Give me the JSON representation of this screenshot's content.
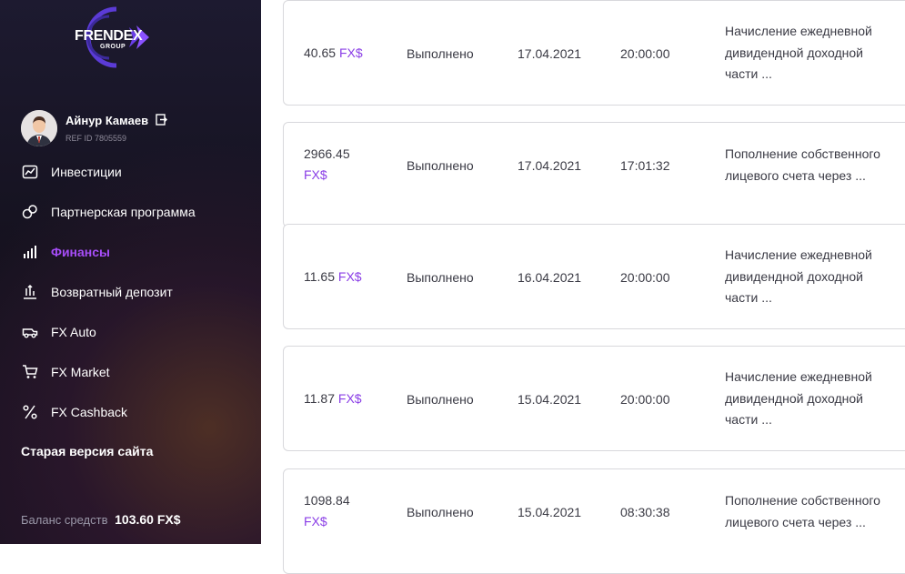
{
  "logo": {
    "main": "FRENDEX",
    "sub": "GROUP"
  },
  "user": {
    "name": "Айнур Камаев",
    "ref": "REF ID 7805559"
  },
  "menu": [
    {
      "label": "Инвестиции",
      "icon": "chart-icon",
      "active": false
    },
    {
      "label": "Партнерская программа",
      "icon": "partner-icon",
      "active": false
    },
    {
      "label": "Финансы",
      "icon": "finance-bars-icon",
      "active": true
    },
    {
      "label": "Возвратный депозит",
      "icon": "deposit-icon",
      "active": false
    },
    {
      "label": "FX Auto",
      "icon": "car-icon",
      "active": false
    },
    {
      "label": "FX Market",
      "icon": "cart-icon",
      "active": false
    },
    {
      "label": "FX Cashback",
      "icon": "percent-icon",
      "active": false
    }
  ],
  "old_site": "Старая версия сайта",
  "balance": {
    "label": "Баланс средств",
    "value": "103.60 FX$"
  },
  "colors": {
    "accent": "#a64df7",
    "sidebar_bg": "#1a1626"
  },
  "transactions": [
    {
      "amount": "40.65",
      "currency": "FX$",
      "status": "Выполнено",
      "date": "17.04.2021",
      "time": "20:00:00",
      "desc_lines": [
        "Начисление ежедневной",
        "дивидендной доходной",
        "части ..."
      ]
    },
    {
      "amount": "2966.45",
      "currency": "FX$",
      "status": "Выполнено",
      "date": "17.04.2021",
      "time": "17:01:32",
      "desc_lines": [
        "Пополнение собственного",
        "лицевого счета через ..."
      ]
    },
    {
      "amount": "11.65",
      "currency": "FX$",
      "status": "Выполнено",
      "date": "16.04.2021",
      "time": "20:00:00",
      "desc_lines": [
        "Начисление ежедневной",
        "дивидендной доходной",
        "части ..."
      ]
    },
    {
      "amount": "11.87",
      "currency": "FX$",
      "status": "Выполнено",
      "date": "15.04.2021",
      "time": "20:00:00",
      "desc_lines": [
        "Начисление ежедневной",
        "дивидендной доходной",
        "части ..."
      ]
    },
    {
      "amount": "1098.84",
      "currency": "FX$",
      "status": "Выполнено",
      "date": "15.04.2021",
      "time": "08:30:38",
      "desc_lines": [
        "Пополнение собственного",
        "лицевого счета через ..."
      ]
    }
  ]
}
